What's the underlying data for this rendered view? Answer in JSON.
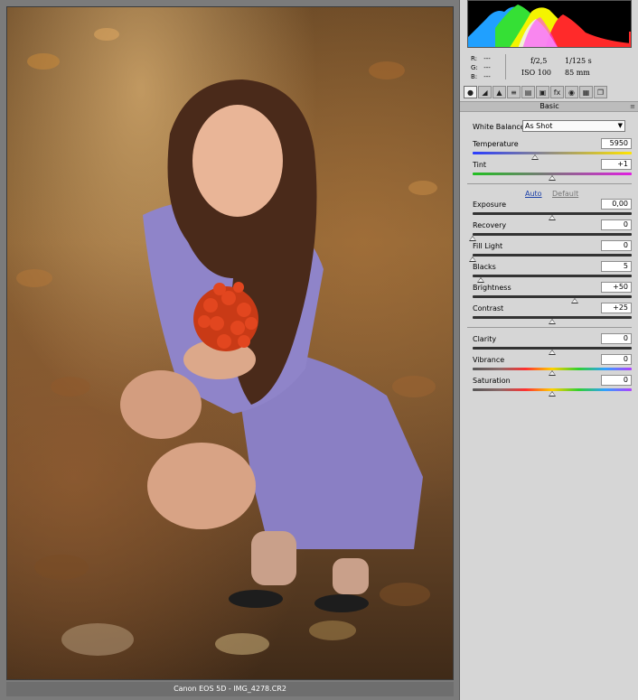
{
  "preview": {
    "caption": "Canon EOS 5D  -  IMG_4278.CR2"
  },
  "readout": {
    "r_label": "R:",
    "r_value": "---",
    "g_label": "G:",
    "g_value": "---",
    "b_label": "B:",
    "b_value": "---",
    "aperture": "f/2,5",
    "shutter": "1/125 s",
    "iso": "ISO 100",
    "focal": "85 mm"
  },
  "toolbar": {
    "icons": [
      "basic-icon",
      "tone-curve-icon",
      "detail-icon",
      "hsl-icon",
      "split-toning-icon",
      "lens-corrections-icon",
      "effects-icon",
      "camera-calibration-icon",
      "presets-icon",
      "snapshots-icon"
    ],
    "fx_glyph": "fx"
  },
  "panel": {
    "section_title": "Basic",
    "white_balance_label": "White Balance:",
    "white_balance_value": "As Shot",
    "auto_label": "Auto",
    "default_label": "Default"
  },
  "controls": {
    "temperature": {
      "label": "Temperature",
      "value": "5950",
      "level": 0.39
    },
    "tint": {
      "label": "Tint",
      "value": "+1",
      "level": 0.5
    },
    "exposure": {
      "label": "Exposure",
      "value": "0,00",
      "level": 0.5
    },
    "recovery": {
      "label": "Recovery",
      "value": "0",
      "level": 0.0
    },
    "fill_light": {
      "label": "Fill Light",
      "value": "0",
      "level": 0.0
    },
    "blacks": {
      "label": "Blacks",
      "value": "5",
      "level": 0.05
    },
    "brightness": {
      "label": "Brightness",
      "value": "+50",
      "level": 0.64
    },
    "contrast": {
      "label": "Contrast",
      "value": "+25",
      "level": 0.5
    },
    "clarity": {
      "label": "Clarity",
      "value": "0",
      "level": 0.5
    },
    "vibrance": {
      "label": "Vibrance",
      "value": "0",
      "level": 0.5
    },
    "saturation": {
      "label": "Saturation",
      "value": "0",
      "level": 0.5
    }
  },
  "colors": {
    "panel_bg": "#d6d6d6",
    "link_blue": "#1a3fa8"
  }
}
